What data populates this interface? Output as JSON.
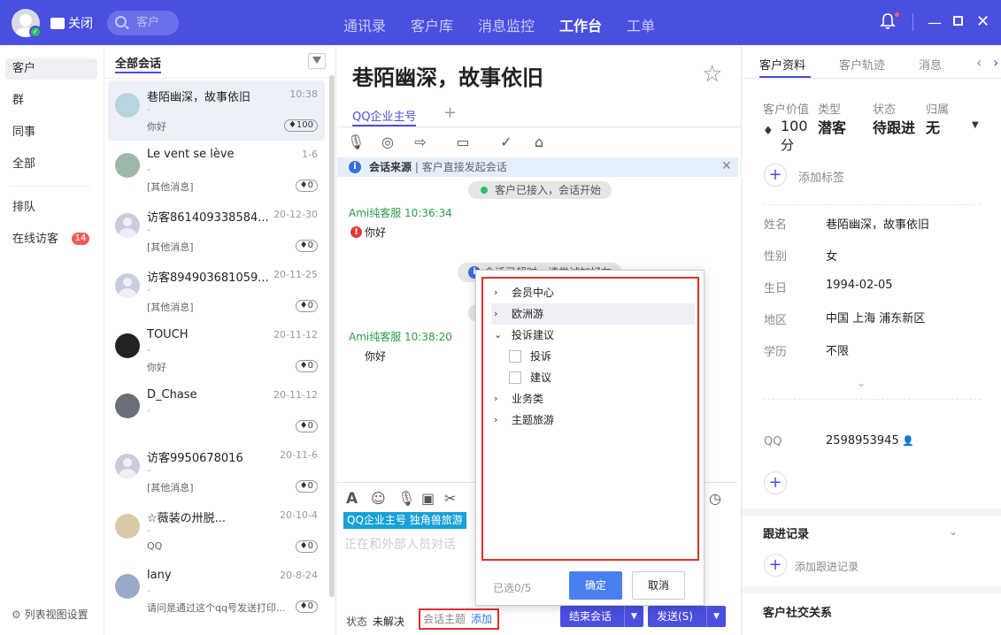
{
  "topbar": {
    "close_label": "关闭",
    "search_placeholder": "客户",
    "nav": [
      "通讯录",
      "客户库",
      "消息监控",
      "工作台",
      "工单"
    ],
    "nav_active": "工作台"
  },
  "leftnav": {
    "items": [
      "客户",
      "群",
      "同事",
      "全部",
      "排队",
      "在线访客"
    ],
    "visitor_badge": "14",
    "settings_label": "列表视图设置"
  },
  "convlist": {
    "title": "全部会话",
    "items": [
      {
        "name": "巷陌幽深，故事依旧",
        "time": "10:38",
        "dash": "-",
        "sub": "你好",
        "value": "100"
      },
      {
        "name": "Le vent se lève",
        "time": "1-6",
        "dash": "-",
        "sub": "[其他消息]",
        "value": "0"
      },
      {
        "name": "访客861409338584...",
        "time": "20-12-30",
        "dash": "-",
        "sub": "[其他消息]",
        "value": "0"
      },
      {
        "name": "访客894903681059...",
        "time": "20-11-25",
        "dash": "-",
        "sub": "[其他消息]",
        "value": "0"
      },
      {
        "name": "TOUCH",
        "time": "20-11-12",
        "dash": "-",
        "sub": "你好",
        "value": "0"
      },
      {
        "name": "D_Chase",
        "time": "20-11-12",
        "dash": "-",
        "sub": "",
        "value": "0"
      },
      {
        "name": "访客9950678016",
        "time": "20-11-6",
        "dash": "-",
        "sub": "[其他消息]",
        "value": "0"
      },
      {
        "name": "☆薇装の卅脱...",
        "time": "20-10-4",
        "dash": "-",
        "sub": "QQ",
        "value": "0"
      },
      {
        "name": "lany",
        "time": "20-8-24",
        "dash": "-",
        "sub": "请问是通过这个qq号发送打印...",
        "value": "0"
      }
    ]
  },
  "chat": {
    "title": "巷陌幽深，故事依旧",
    "tab": "QQ企业主号",
    "source_label": "会话来源",
    "source_text": "| 客户直接发起会话",
    "sys_joined": "客户已接入，会话开始",
    "sys_timeout": "会话已超时，请尝试加好友",
    "messages": [
      {
        "head": "Ami纯客服  10:36:34",
        "body": "你好"
      },
      {
        "head": "Ami纯客服  10:38:20",
        "body": "你好"
      }
    ],
    "compose_tag": "QQ企业主号 独角兽旅游",
    "compose_placeholder": "正在和外部人员对话",
    "status_label": "状态",
    "status_value": "未解决",
    "topic_label": "会话主题",
    "topic_add": "添加",
    "end_label": "结束会话",
    "send_label": "发送(S)"
  },
  "popup": {
    "tree": [
      {
        "label": "会员中心",
        "type": "collapsed"
      },
      {
        "label": "欧洲游",
        "type": "collapsed"
      },
      {
        "label": "投诉建议",
        "type": "expanded"
      },
      {
        "label": "投诉",
        "type": "checkbox"
      },
      {
        "label": "建议",
        "type": "checkbox"
      },
      {
        "label": "业务类",
        "type": "collapsed"
      },
      {
        "label": "主题旅游",
        "type": "collapsed"
      }
    ],
    "selected": "已选0/5",
    "ok": "确定",
    "cancel": "取消"
  },
  "rpanel": {
    "tabs": [
      "客户资料",
      "客户轨迹",
      "消息"
    ],
    "value_label": "客户价值",
    "value": "100",
    "value_unit": "分",
    "type_label": "类型",
    "type_value": "潜客",
    "status_label": "状态",
    "status_value": "待跟进",
    "owner_label": "归属",
    "owner_value": "无",
    "add_tag": "添加标签",
    "fields": [
      {
        "label": "姓名",
        "value": "巷陌幽深，故事依旧"
      },
      {
        "label": "性别",
        "value": "女"
      },
      {
        "label": "生日",
        "value": "1994-02-05"
      },
      {
        "label": "地区",
        "value": "中国 上海 浦东新区"
      },
      {
        "label": "学历",
        "value": "不限"
      }
    ],
    "qq_label": "QQ",
    "qq_value": "2598953945",
    "followup_title": "跟进记录",
    "add_followup": "添加跟进记录",
    "social_title": "客户社交关系"
  },
  "colors": {
    "brand": "#4a4fe0",
    "highlight_box": "#e52e2e"
  }
}
